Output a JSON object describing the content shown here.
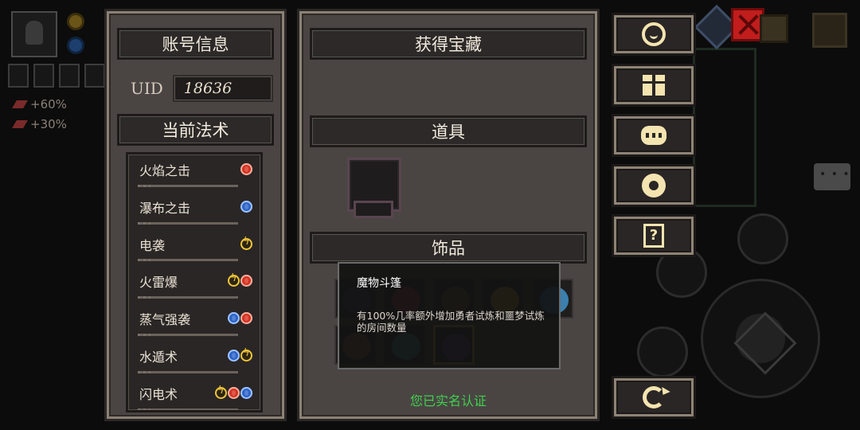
{
  "hud": {
    "buffs": [
      "+60%",
      "+30%"
    ]
  },
  "account_panel": {
    "title": "账号信息",
    "uid_label": "UID",
    "uid_value": "18636",
    "spells_title": "当前法术",
    "spells": [
      {
        "name": "火焰之击",
        "elements": [
          "fire"
        ]
      },
      {
        "name": "瀑布之击",
        "elements": [
          "water"
        ]
      },
      {
        "name": "电袭",
        "elements": [
          "thunder"
        ]
      },
      {
        "name": "火雷爆",
        "elements": [
          "thunder",
          "fire"
        ]
      },
      {
        "name": "蒸气强袭",
        "elements": [
          "water",
          "fire"
        ]
      },
      {
        "name": "水遁术",
        "elements": [
          "water",
          "thunder"
        ]
      },
      {
        "name": "闪电术",
        "elements": [
          "thunder",
          "fire",
          "water"
        ]
      }
    ]
  },
  "treasure_panel": {
    "title": "获得宝藏",
    "items_title": "道具",
    "accessories_title": "饰品",
    "accessories": [
      {
        "name": "accessory-1",
        "color": "#3b2e5a"
      },
      {
        "name": "accessory-2",
        "color": "#a0323a"
      },
      {
        "name": "accessory-3",
        "color": "#6b5a2a"
      },
      {
        "name": "accessory-4",
        "color": "#c8952f"
      },
      {
        "name": "accessory-5",
        "color": "#3a7fb0"
      },
      {
        "name": "accessory-6",
        "color": "#7a5a3a"
      },
      {
        "name": "accessory-7",
        "color": "#3f8f8a"
      },
      {
        "name": "accessory-8",
        "color": "#5a3f7a"
      }
    ],
    "tooltip": {
      "title": "魔物斗篷",
      "description": "有100%几率额外增加勇者试炼和噩梦试炼的房间数量"
    },
    "verification_text": "您已实名认证"
  },
  "side_buttons": [
    {
      "name": "customer-service-button",
      "icon": "headset-icon"
    },
    {
      "name": "gift-button",
      "icon": "gift-icon"
    },
    {
      "name": "community-button",
      "icon": "bee-icon"
    },
    {
      "name": "settings-button",
      "icon": "gear-icon"
    },
    {
      "name": "help-button",
      "icon": "help-book-icon",
      "glyph": "?"
    },
    {
      "name": "switch-account-button",
      "icon": "refresh-icon"
    }
  ],
  "colors": {
    "panel_bg": "#4a4543",
    "header_bg": "#2c2928",
    "verified_green": "#3fd04e",
    "fire": "#d6311f",
    "water": "#2c63c8",
    "thunder": "#f0c53a"
  }
}
